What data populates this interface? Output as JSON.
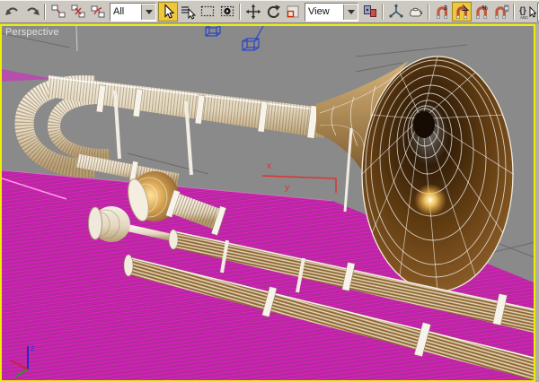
{
  "toolbar": {
    "selection_filter_value": "All",
    "reference_coord_value": "View",
    "snap_3d_badge": "3",
    "snap_percent_badge": "%",
    "named_sets_glyph": "{}",
    "named_sets_abc": "ABC",
    "active_buttons": [
      "select-object",
      "angle-snap-toggle"
    ],
    "icons": [
      "undo-icon",
      "redo-icon",
      "select-and-link-icon",
      "unlink-selection-icon",
      "bind-to-space-warp-icon",
      "selection-filter-dropdown",
      "select-object-icon",
      "select-by-name-icon",
      "rectangular-selection-region-icon",
      "window-crossing-icon",
      "select-and-move-icon",
      "select-and-rotate-icon",
      "select-and-scale-icon",
      "reference-coordinate-dropdown",
      "use-pivot-point-center-icon",
      "select-and-manipulate-icon",
      "keyboard-override-icon",
      "snap-toggle-3d-icon",
      "angle-snap-toggle-icon",
      "percent-snap-icon",
      "spinner-snap-icon",
      "named-selection-sets-icon"
    ]
  },
  "viewport": {
    "label": "Perspective",
    "gizmo_x_label": "x",
    "gizmo_y_label": "y",
    "world_axis_z_label": "z"
  },
  "colors": {
    "toolbar_bg": "#cdc9c1",
    "active_button": "#eec73e",
    "viewport_border": "#edee06",
    "viewport_bg": "#8a8a8a",
    "ground_plane_magenta": "#c119aa",
    "bell_brown": "#7a4a1c",
    "tube_cream": "#ece4d2",
    "helper_blue": "#2b46c8",
    "gizmo_red": "#e03030"
  }
}
